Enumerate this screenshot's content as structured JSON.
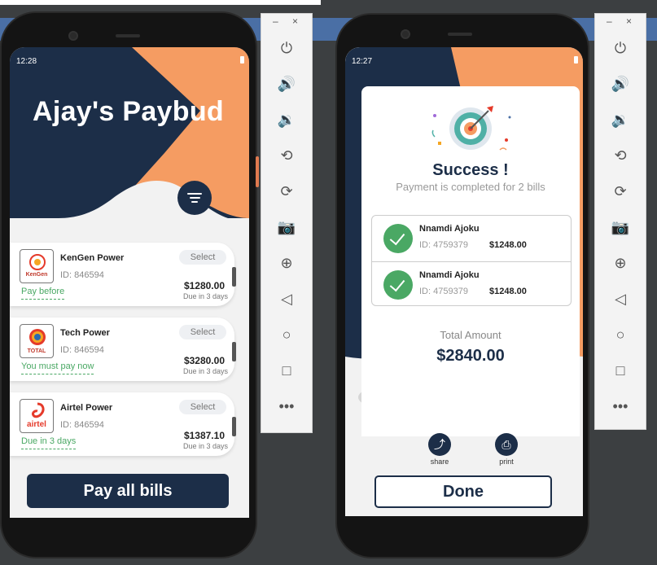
{
  "left_phone": {
    "status_time": "12:28",
    "app_title": "Ajay's Paybud",
    "bills": [
      {
        "provider": "KenGen Power",
        "logo": "kengen-logo",
        "id_text": "ID: 846594",
        "select_label": "Select",
        "amount": "$1280.00",
        "due": "Due in 3 days",
        "note": "Pay before"
      },
      {
        "provider": "Tech Power",
        "logo": "total-logo",
        "id_text": "ID: 846594",
        "select_label": "Select",
        "amount": "$3280.00",
        "due": "Due in 3 days",
        "note": "You must pay now"
      },
      {
        "provider": "Airtel Power",
        "logo": "airtel-logo",
        "id_text": "ID: 846594",
        "select_label": "Select",
        "amount": "$1387.10",
        "due": "Due in 3 days",
        "note": "Due in 3 days"
      }
    ],
    "logo_text": {
      "kengen": "KenGen",
      "total": "TOTAL",
      "airtel": "airtel"
    },
    "pay_all_label": "Pay all bills"
  },
  "right_phone": {
    "status_time": "12:27",
    "success_title": "Success !",
    "success_subtitle": "Payment is completed for 2 bills",
    "paid": [
      {
        "name": "Nnamdi Ajoku",
        "id_text": "ID: 4759379",
        "amount": "$1248.00"
      },
      {
        "name": "Nnamdi Ajoku",
        "id_text": "ID: 4759379",
        "amount": "$1248.00"
      }
    ],
    "total_label": "Total Amount",
    "total_value": "$2840.00",
    "share_label": "share",
    "print_label": "print",
    "done_label": "Done"
  },
  "toolbar": {
    "minimize": "–",
    "close": "×",
    "items": [
      "power-icon",
      "volume-up-icon",
      "volume-down-icon",
      "rotate-left-icon",
      "rotate-right-icon",
      "camera-icon",
      "zoom-icon",
      "back-icon",
      "home-icon",
      "overview-icon",
      "more-icon"
    ]
  },
  "colors": {
    "navy": "#1c2e48",
    "orange": "#f59c62",
    "green": "#4aa864",
    "strip": "#4a6fa5"
  }
}
